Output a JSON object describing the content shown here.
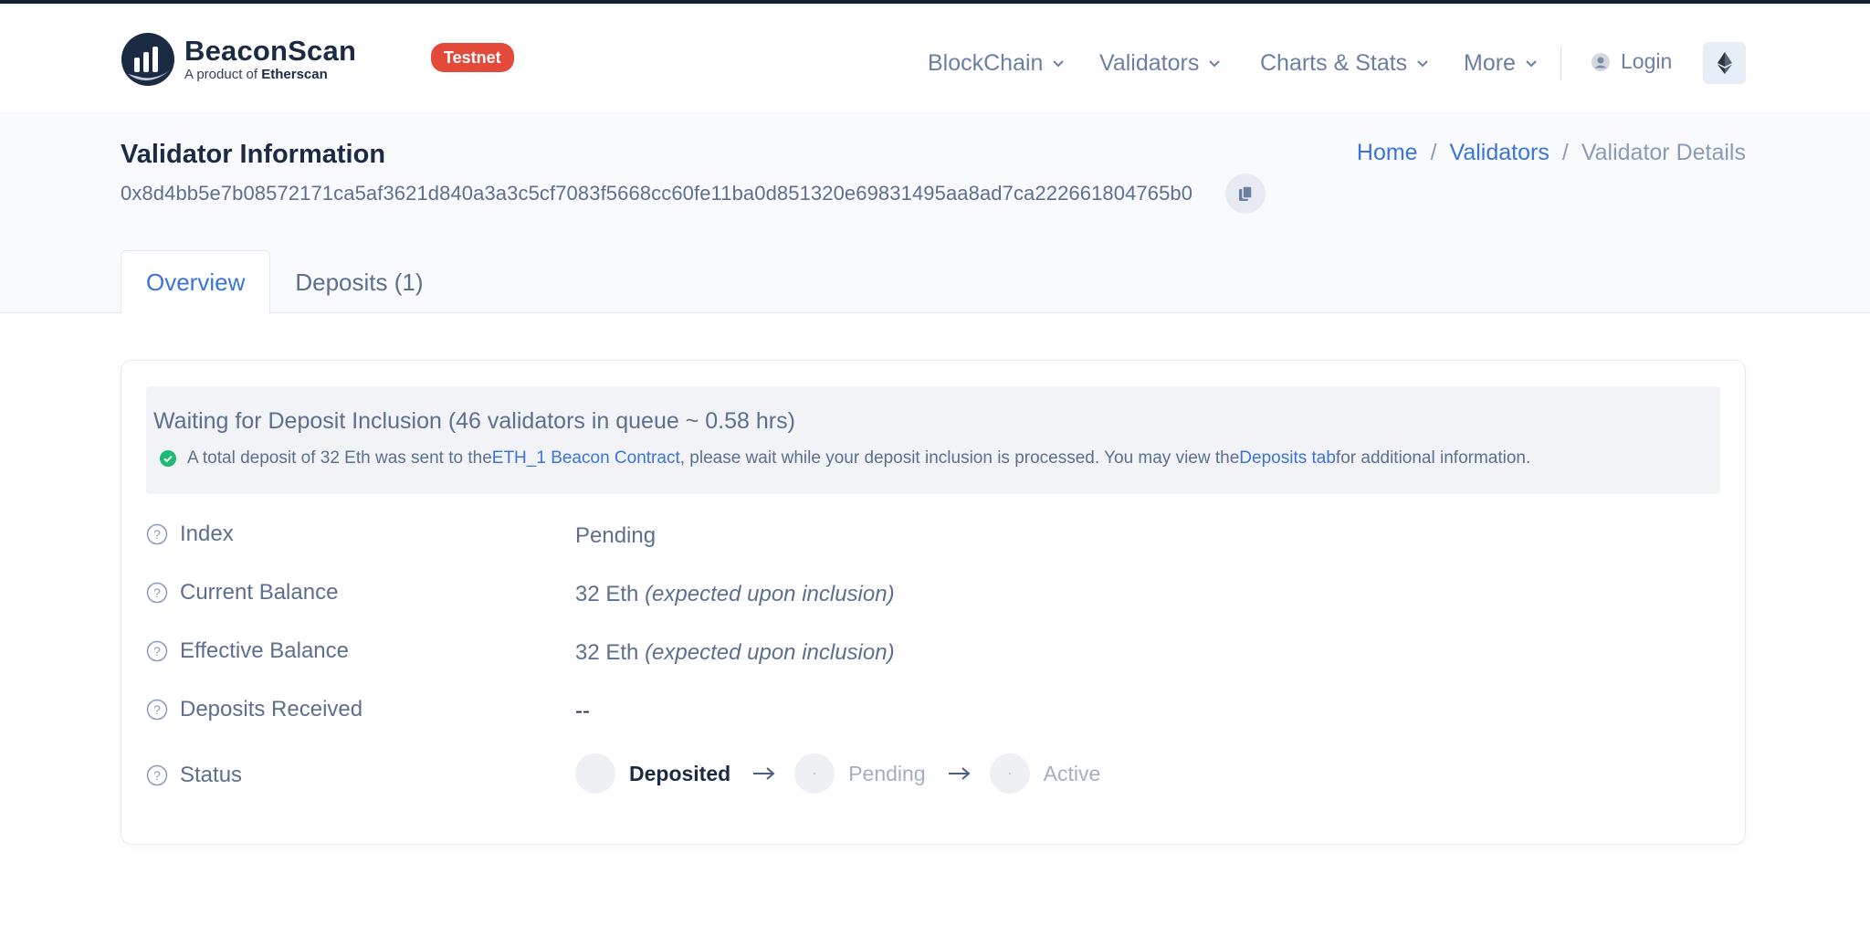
{
  "header": {
    "brand_name": "BeaconScan",
    "brand_sub_prefix": "A product of",
    "brand_sub_name": "Etherscan",
    "badge": "Testnet",
    "nav": [
      "BlockChain",
      "Validators",
      "Charts & Stats",
      "More"
    ],
    "login": "Login",
    "icons": {
      "network": "ethereum-icon",
      "user": "user-icon",
      "dropdown": "chevron-down-icon"
    }
  },
  "page": {
    "title": "Validator Information",
    "address": "0x8d4bb5e7b08572171ca5af3621d840a3a3c5cf7083f5668cc60fe11ba0d851320e69831495aa8ad7ca222661804765b0",
    "breadcrumb": {
      "home": "Home",
      "validators": "Validators",
      "current": "Validator Details",
      "separator": "/"
    },
    "tabs": [
      "Overview",
      "Deposits (1)"
    ]
  },
  "alert": {
    "title": "Waiting for Deposit Inclusion (46 validators in queue ~ 0.58 hrs)",
    "text_1": "A total deposit of 32 Eth was sent to the ",
    "link_1": "ETH_1 Beacon Contract",
    "text_2": ", please wait while your deposit inclusion is processed. You may view the ",
    "link_2": "Deposits tab",
    "text_3": " for additional information."
  },
  "details": {
    "index": {
      "label": "Index",
      "value": "Pending"
    },
    "current_balance": {
      "label": "Current Balance",
      "value": "32 Eth",
      "note": "(expected upon inclusion)"
    },
    "effective_balance": {
      "label": "Effective Balance",
      "value": "32 Eth",
      "note": "(expected upon inclusion)"
    },
    "deposits_received": {
      "label": "Deposits Received",
      "value": "--"
    },
    "status": {
      "label": "Status",
      "steps": [
        "Deposited",
        "Pending",
        "Active"
      ]
    }
  },
  "colors": {
    "accent": "#3b74d8",
    "badge": "#e34a3a",
    "success": "#1fb978",
    "text": "#5c6f8f",
    "heading": "#1b2b44"
  }
}
